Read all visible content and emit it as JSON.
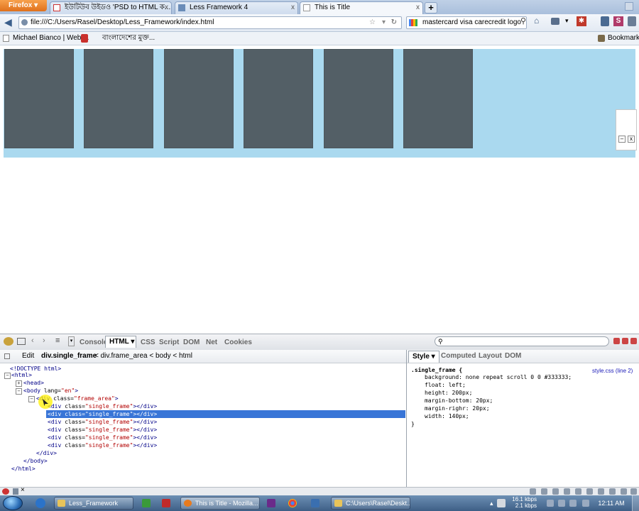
{
  "browser": {
    "menu_button": "Firefox",
    "tabs": [
      {
        "label": "ইউটিউব উইডও  'PSD to HTML ক...",
        "active": false
      },
      {
        "label": "Less Framework 4",
        "active": false
      },
      {
        "label": "This is Title",
        "active": true
      }
    ],
    "new_tab": "+",
    "tab_close": "x",
    "url": "file:///C:/Users/Rasel/Desktop/Less_Framework/index.html",
    "search_value": "mastercard visa carecredit logo",
    "bookmarks": [
      {
        "label": "Michael Bianco | Web ..."
      },
      {
        "label": "বাংলাদেশের মুক্ত..."
      }
    ],
    "bookmarks_menu": "Bookmarks"
  },
  "page": {
    "frame_area_color": "#aad9ef",
    "frame_color": "#535f66",
    "frames": [
      "frame-1",
      "frame-2",
      "frame-3",
      "frame-4",
      "frame-5",
      "frame-6"
    ],
    "widget_min": "–",
    "widget_close": "x"
  },
  "firebug": {
    "tabs": [
      "Console",
      "HTML",
      "CSS",
      "Script",
      "DOM",
      "Net",
      "Cookies"
    ],
    "active_tab": "HTML",
    "edit_label": "Edit",
    "breadcrumb": {
      "current": "div.single_frame",
      "rest": "< div.frame_area < body < html"
    },
    "side_tabs": [
      "Style",
      "Computed",
      "Layout",
      "DOM"
    ],
    "tree": [
      {
        "text": "<!DOCTYPE html>"
      },
      {
        "open": "<html>"
      },
      {
        "open": "<head>"
      },
      {
        "tag": "<body",
        "attr": " lang=",
        "val": "\"en\"",
        "end": ">"
      },
      {
        "tag": "<div",
        "attr": " class=",
        "val": "\"frame_area\"",
        "end": ">"
      },
      {
        "tag": "<div",
        "attr": " class=",
        "val": "\"single_frame\"",
        "end": "></div>"
      },
      {
        "tag": "<div",
        "attr": " class=",
        "val": "\"single_frame\"",
        "end": "></div>"
      },
      {
        "tag": "<div",
        "attr": " class=",
        "val": "\"single_frame\"",
        "end": "></div>"
      },
      {
        "tag": "<div",
        "attr": " class=",
        "val": "\"single_frame\"",
        "end": "></div>"
      },
      {
        "tag": "<div",
        "attr": " class=",
        "val": "\"single_frame\"",
        "end": "></div>"
      },
      {
        "tag": "<div",
        "attr": " class=",
        "val": "\"single_frame\"",
        "end": "></div>"
      },
      {
        "close": "</div>"
      },
      {
        "close": "</body>"
      },
      {
        "close": "</html>"
      }
    ],
    "css": {
      "selector": ".single_frame {",
      "source": "style.css (line 2)",
      "rules": [
        "background: none repeat scroll 0 0 #333333;",
        "float: left;",
        "height: 200px;",
        "margin-bottom: 20px;",
        "margin-righr: 20px;",
        "width: 140px;"
      ],
      "close": "}"
    }
  },
  "taskbar": {
    "items": [
      {
        "label": "Less_Framework"
      },
      {
        "label": "This is Title - Mozilla..."
      },
      {
        "label": "C:\\Users\\Rasel\\Deskt..."
      }
    ],
    "net_up": "16.1 kbps",
    "net_down": "2.1 kbps",
    "clock": "12:11 AM"
  }
}
